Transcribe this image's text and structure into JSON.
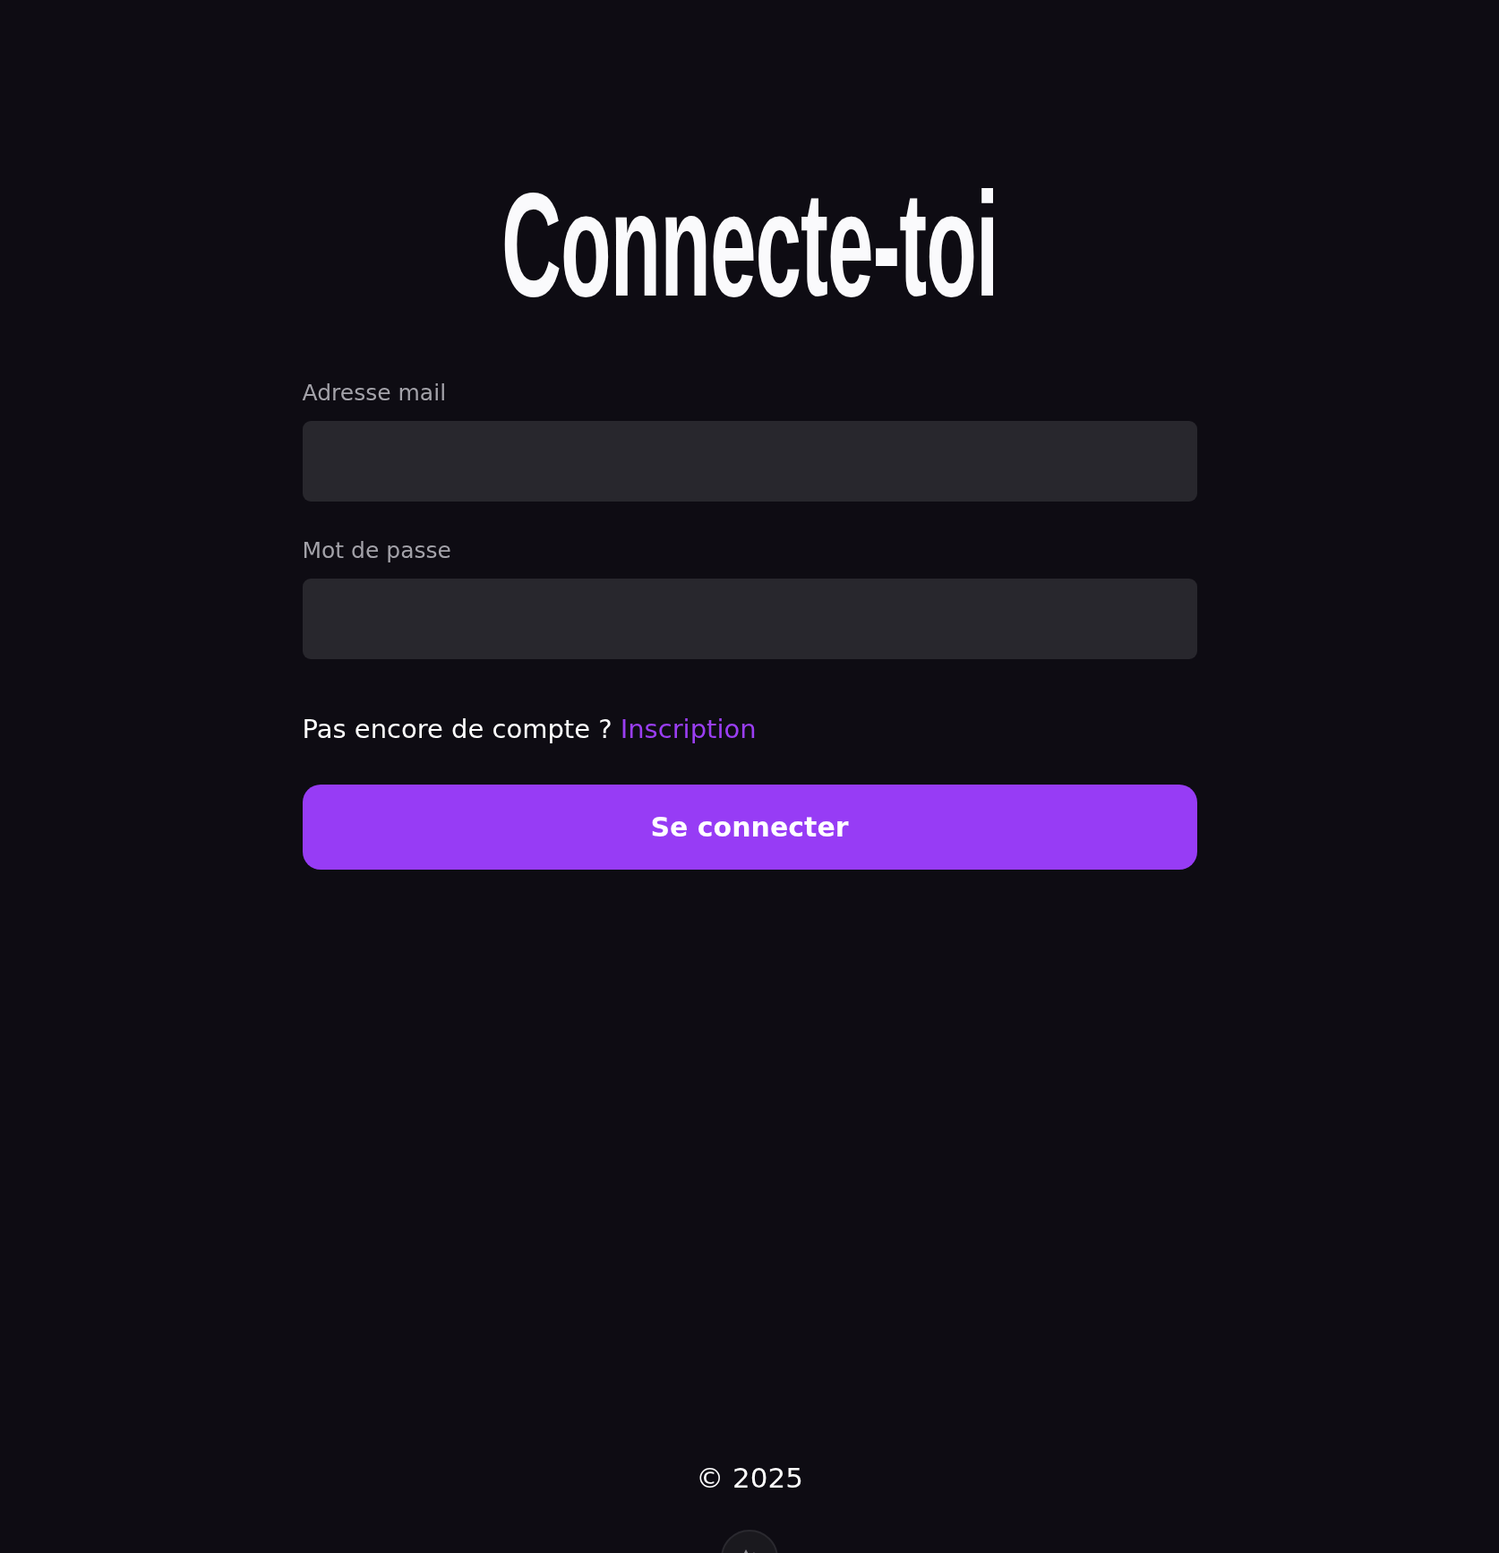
{
  "title": "Connecte-toi",
  "fields": [
    {
      "label": "Adresse mail"
    },
    {
      "label": "Mot de passe"
    }
  ],
  "signup": {
    "prompt": "Pas encore de compte ?",
    "link": "Inscription"
  },
  "submit_button": "Se connecter",
  "footer": {
    "copyright": "© 2025"
  }
}
